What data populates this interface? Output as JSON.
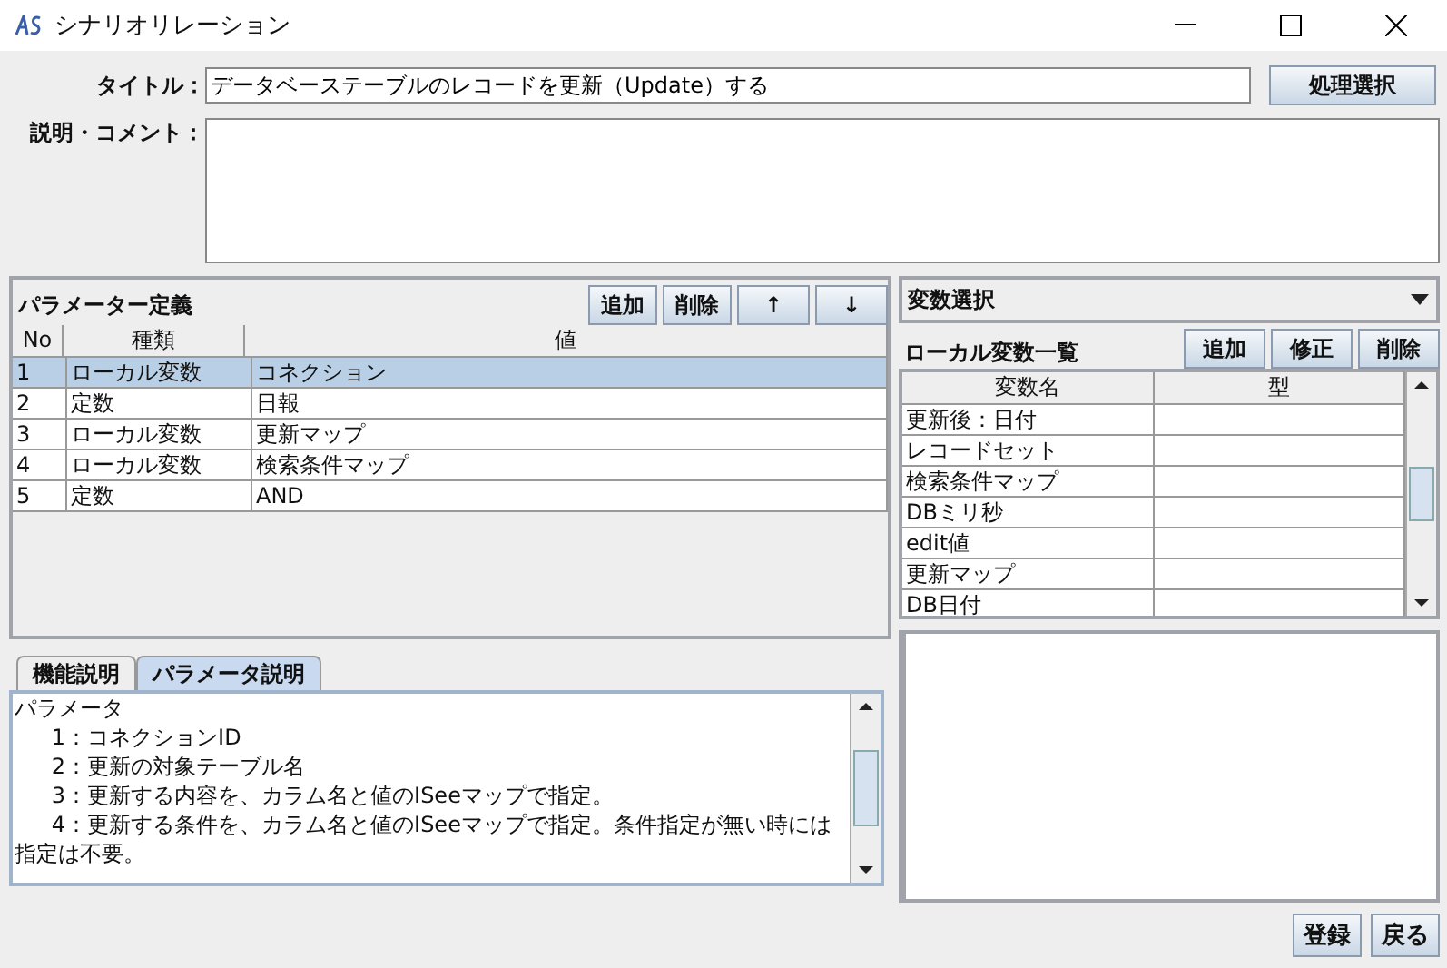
{
  "window": {
    "title": "シナリオリレーション"
  },
  "form": {
    "title_label": "タイトル：",
    "title_value": "データベーステーブルのレコードを更新（Update）する",
    "select_button": "処理選択",
    "comment_label": "説明・コメント："
  },
  "parameters": {
    "title": "パラメーター定義",
    "buttons": [
      "追加",
      "削除",
      "↑",
      "↓"
    ],
    "columns": [
      "No",
      "種類",
      "値"
    ],
    "rows": [
      {
        "cells": [
          "1",
          "ローカル変数",
          "コネクション"
        ],
        "selected": true
      },
      {
        "cells": [
          "2",
          "定数",
          "日報"
        ],
        "selected": false
      },
      {
        "cells": [
          "3",
          "ローカル変数",
          "更新マップ"
        ],
        "selected": false
      },
      {
        "cells": [
          "4",
          "ローカル変数",
          "検索条件マップ"
        ],
        "selected": false
      },
      {
        "cells": [
          "5",
          "定数",
          "AND"
        ],
        "selected": false
      }
    ]
  },
  "variables": {
    "dropdown": "変数選択",
    "title": "ローカル変数一覧",
    "buttons": [
      "追加",
      "修正",
      "削除"
    ],
    "columns": [
      "変数名",
      "型"
    ],
    "rows": [
      "更新後：日付",
      "レコードセット",
      "検索条件マップ",
      "DBミリ秒",
      "edit値",
      "更新マップ",
      "DB日付"
    ]
  },
  "help": {
    "tabs": [
      {
        "label": "機能説明",
        "selected": false
      },
      {
        "label": "パラメータ説明",
        "selected": true
      }
    ],
    "heading": "パラメータ",
    "items": [
      "1：コネクションID",
      "2：更新の対象テーブル名",
      "3：更新する内容を、カラム名と値のISeeマップで指定。",
      "4：更新する条件を、カラム名と値のISeeマップで指定。条件指定が無い時には指定は不要。"
    ]
  },
  "footer": {
    "buttons": [
      "登録",
      "戻る"
    ]
  }
}
